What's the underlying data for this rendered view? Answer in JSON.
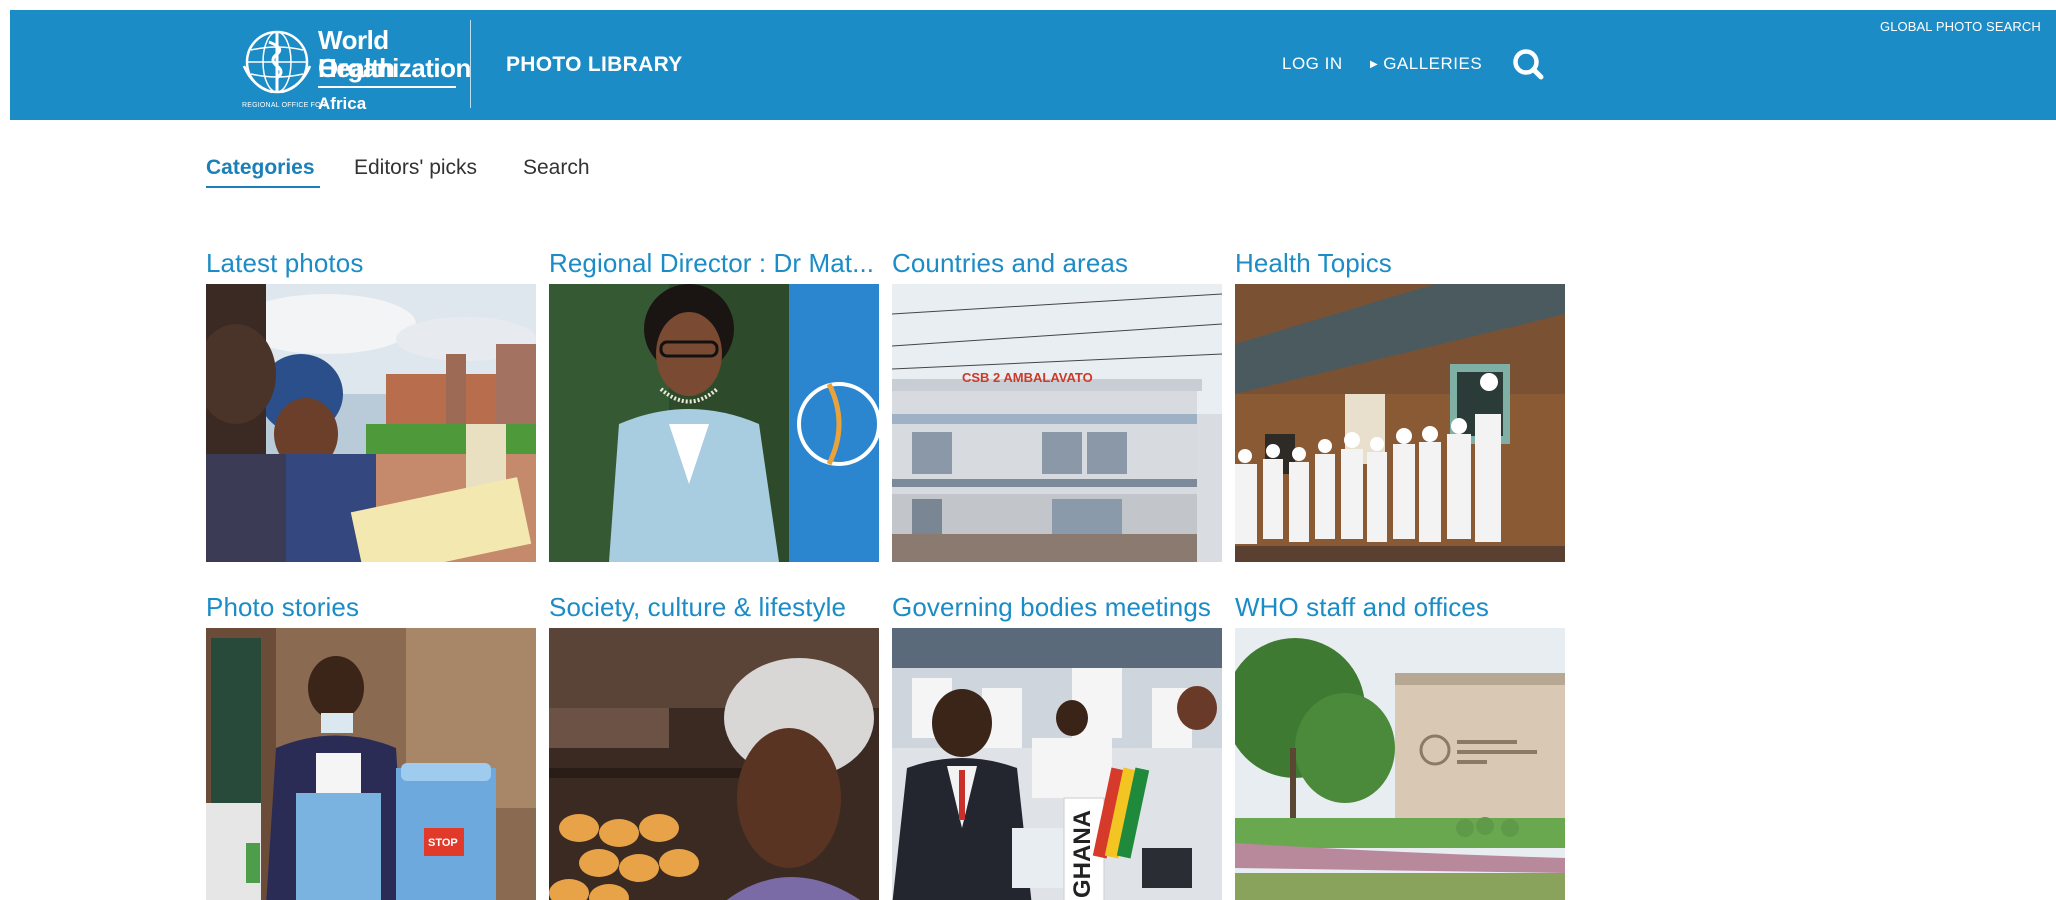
{
  "header": {
    "logo": {
      "line1": "World Health",
      "line2": "Organization",
      "region_small": "REGIONAL OFFICE FOR",
      "region": "Africa",
      "emblem_icon": "who-emblem-icon"
    },
    "site_title": "PHOTO LIBRARY",
    "nav": {
      "login": "LOG IN",
      "galleries": "GALLERIES",
      "search_icon": "search-icon"
    },
    "global_search": "GLOBAL PHOTO SEARCH"
  },
  "tabs": [
    {
      "label": "Categories",
      "active": true
    },
    {
      "label": "Editors' picks",
      "active": false
    },
    {
      "label": "Search",
      "active": false
    }
  ],
  "categories": [
    {
      "title": "Latest photos"
    },
    {
      "title": "Regional Director : Dr Mat..."
    },
    {
      "title": "Countries and areas"
    },
    {
      "title": "Health Topics"
    },
    {
      "title": "Photo stories"
    },
    {
      "title": "Society, culture & lifestyle"
    },
    {
      "title": "Governing bodies meetings"
    },
    {
      "title": "WHO staff and offices"
    }
  ],
  "photo_text": {
    "clinic_sign": "CSB 2 AMBALAVATO",
    "country_placard": "GHANA",
    "cooler_label": "STOP"
  },
  "colors": {
    "header_bg": "#1b8cc6",
    "link_blue": "#1b8cc6",
    "active_tab": "#1b7fb8"
  }
}
